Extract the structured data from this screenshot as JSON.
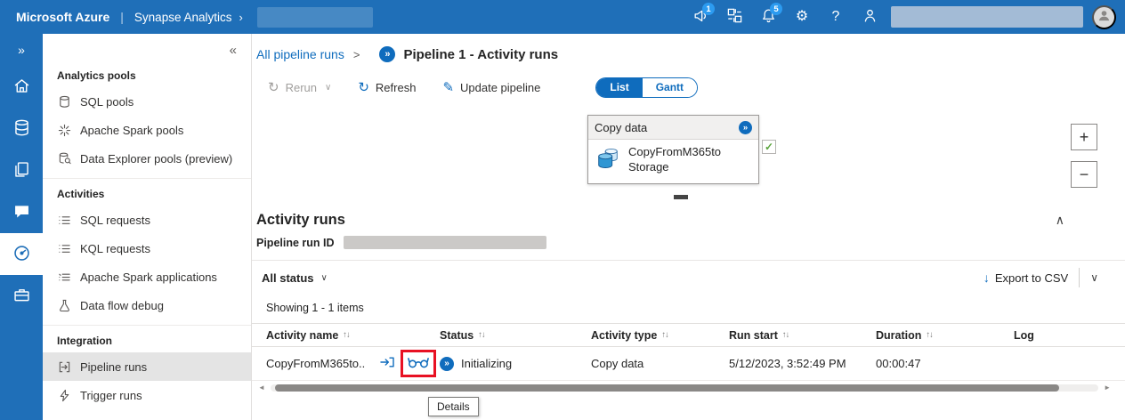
{
  "glyphs": {
    "circle_arrow": "»"
  },
  "topbar": {
    "brand": "Microsoft Azure",
    "separator": "|",
    "product": "Synapse Analytics",
    "product_chevron": "›",
    "announce_badge": "1",
    "bell_badge": "5",
    "gear_glyph": "⚙",
    "help_glyph": "?"
  },
  "rail": {
    "expand_glyph": "»"
  },
  "sidebar": {
    "collapse_glyph": "«",
    "sections": [
      {
        "title": "Analytics pools",
        "items": [
          {
            "label": "SQL pools"
          },
          {
            "label": "Apache Spark pools"
          },
          {
            "label": "Data Explorer pools (preview)"
          }
        ]
      },
      {
        "title": "Activities",
        "items": [
          {
            "label": "SQL requests"
          },
          {
            "label": "KQL requests"
          },
          {
            "label": "Apache Spark applications"
          },
          {
            "label": "Data flow debug"
          }
        ]
      },
      {
        "title": "Integration",
        "items": [
          {
            "label": "Pipeline runs",
            "selected": true
          },
          {
            "label": "Trigger runs"
          }
        ]
      }
    ]
  },
  "breadcrumb": {
    "parent": "All pipeline runs",
    "separator": ">",
    "current": "Pipeline 1 - Activity runs"
  },
  "toolbar": {
    "rerun_glyph": "↻",
    "rerun_label": "Rerun",
    "rerun_chevron": "∨",
    "refresh_glyph": "↻",
    "refresh_label": "Refresh",
    "update_glyph": "✎",
    "update_label": "Update pipeline",
    "list_label": "List",
    "gantt_label": "Gantt"
  },
  "canvas": {
    "node_header": "Copy data",
    "node_name": "CopyFromM365toStorage",
    "check_glyph": "✓",
    "zoom_in": "+",
    "zoom_out": "−"
  },
  "activity": {
    "title": "Activity runs",
    "collapse_glyph": "∧",
    "run_id_label": "Pipeline run ID",
    "status_filter": "All status",
    "filter_chevron": "∨",
    "export_glyph": "↓",
    "export_label": "Export to CSV",
    "more_chevron": "∨",
    "showing": "Showing 1 - 1 items",
    "sort_glyph": "↑↓",
    "columns": [
      "Activity name",
      "Status",
      "Activity type",
      "Run start",
      "Duration",
      "Log"
    ],
    "row": {
      "name": "CopyFromM365to...",
      "status": "Initializing",
      "type": "Copy data",
      "run_start": "5/12/2023, 3:52:49 PM",
      "duration": "00:00:47"
    },
    "tooltip": "Details",
    "scroll_left_glyph": "◄",
    "scroll_right_glyph": "►"
  }
}
